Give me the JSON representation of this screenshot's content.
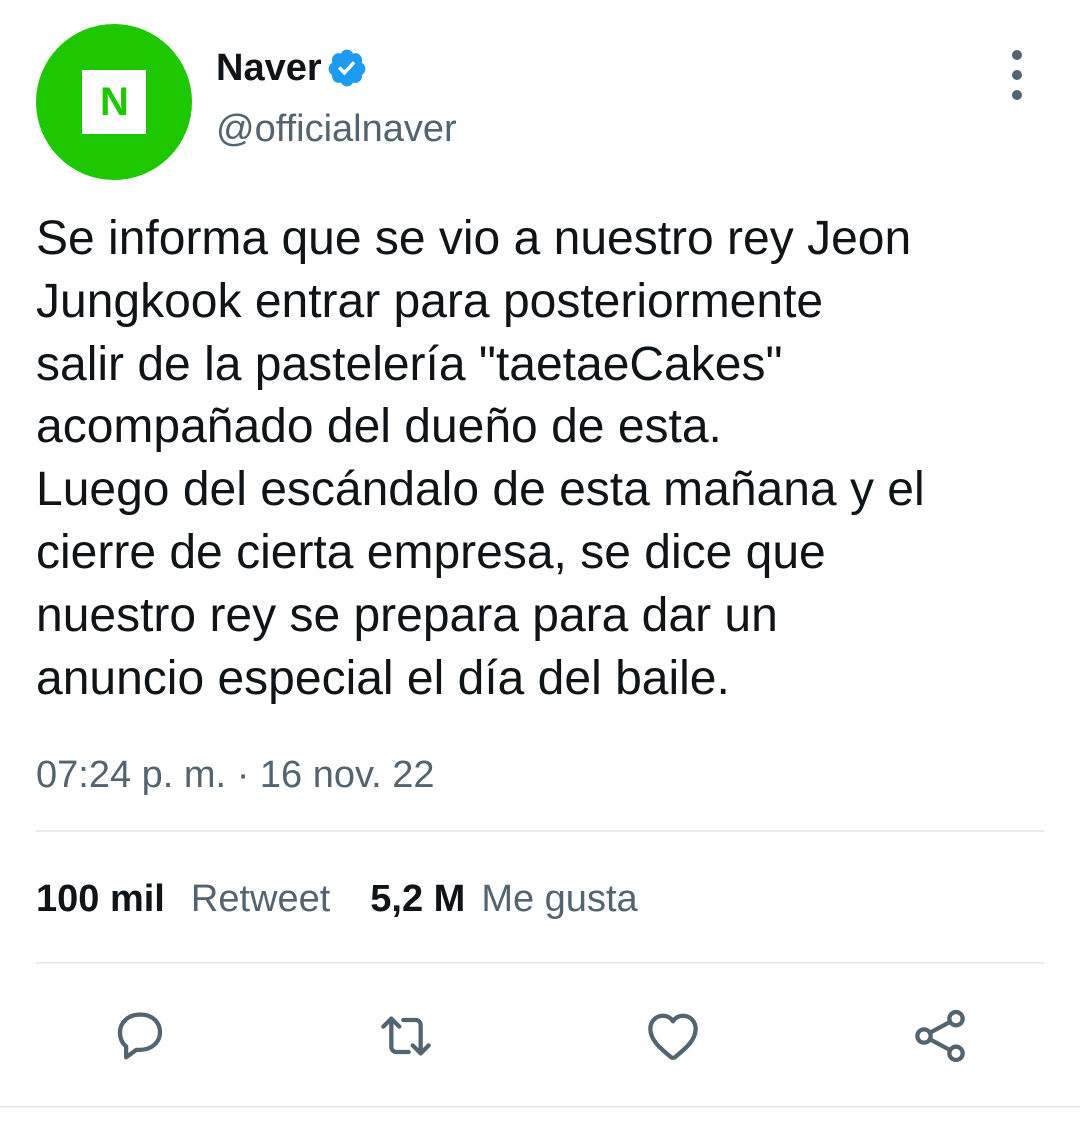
{
  "tweet": {
    "avatar_letter": "N",
    "avatar_color": "#1ec800",
    "display_name": "Naver",
    "verified_icon": "verified-badge-icon",
    "verified_color": "#1d9bf0",
    "handle": "@officialnaver",
    "more_icon": "more-vertical-icon",
    "text_lines": [
      "Se informa que se vio a nuestro rey Jeon",
      "Jungkook entrar para posteriormente",
      "salir de la pastelería \"taetaeCakes\"",
      "acompañado del dueño de esta.",
      "Luego del escándalo de esta mañana y el",
      "cierre de cierta empresa, se dice que",
      "nuestro rey se prepara para dar un",
      "anuncio especial el día del baile."
    ],
    "time": "07:24 p. m.",
    "separator": "·",
    "date": "16 nov. 22"
  },
  "stats": {
    "retweets_count": "100 mil",
    "retweets_label": "Retweet",
    "likes_count": "5,2 M",
    "likes_label": "Me gusta"
  },
  "actions": [
    {
      "icon": "reply-icon"
    },
    {
      "icon": "retweet-icon"
    },
    {
      "icon": "like-icon"
    },
    {
      "icon": "share-icon"
    }
  ],
  "colors": {
    "text_primary": "#0f1419",
    "text_secondary": "#536471",
    "divider": "#e6ecf0"
  }
}
